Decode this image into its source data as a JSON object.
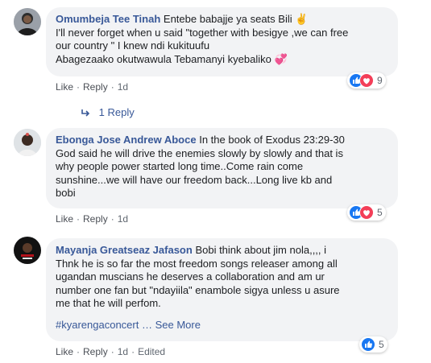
{
  "comments": [
    {
      "author": "Omumbeja Tee Tinah",
      "first_line": "Entebe babajje ya seats Bili ✌️",
      "lines": [
        "I'll never forget when u said \"together with besigye ,we can free",
        "our country \" I knew ndi kukituufu",
        "Abagezaako okutwawula Tebamanyi kyebaliko 💞"
      ],
      "like": "Like",
      "reply": "Reply",
      "time": "1d",
      "reactions_count": "9",
      "reaction_icons": [
        "like-icon",
        "heart-icon"
      ]
    },
    {
      "author": "Ebonga Jose Andrew Aboce",
      "first_line": "In the book of Exodus 23:29-30",
      "lines": [
        "God said he will drive the enemies slowly by slowly and that is",
        "why people power started long time..Come rain come",
        "sunshine...we will have our freedom back...Long live kb and",
        "bobi"
      ],
      "like": "Like",
      "reply": "Reply",
      "time": "1d",
      "reactions_count": "5",
      "reaction_icons": [
        "like-icon",
        "heart-icon"
      ]
    },
    {
      "author": "Mayanja Greatseaz Jafason",
      "first_line": "Bobi think about jim nola,,,, i",
      "lines": [
        "Thnk he is so far the most freedom songs releaser among all",
        "ugandan muscians he deserves a collaboration and am ur",
        "number one fan but \"ndayiila\" enambole sigya unless u asure",
        "me that he will perfom."
      ],
      "hashtag": "#kyarengaconcert",
      "see_more": "… See More",
      "like": "Like",
      "reply": "Reply",
      "time": "1d",
      "edited": "Edited",
      "reactions_count": "5",
      "reaction_icons": [
        "like-icon"
      ]
    }
  ],
  "replies_link": "1 Reply",
  "colors": {
    "link": "#385898",
    "bubble": "#f2f3f5",
    "like": "#1877f2",
    "love": "#f33e58"
  }
}
